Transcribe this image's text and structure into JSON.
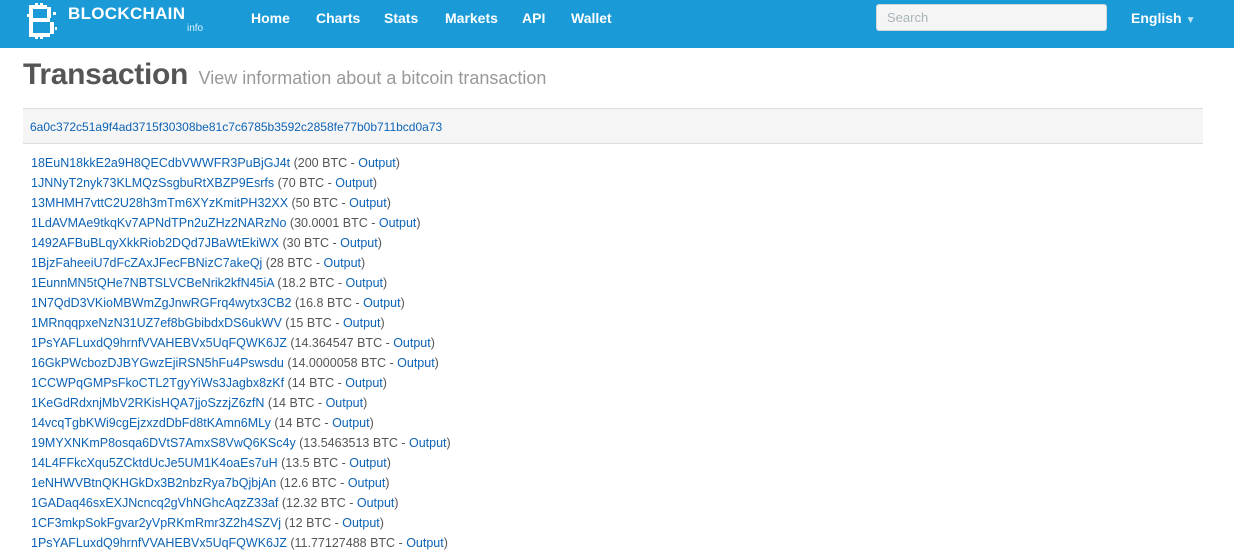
{
  "nav": {
    "brand": "BLOCKCHAIN",
    "brand_sub": "info",
    "links": [
      "Home",
      "Charts",
      "Stats",
      "Markets",
      "API",
      "Wallet"
    ],
    "search_placeholder": "Search",
    "language": "English"
  },
  "colors": {
    "navbar": "#1a9bd7",
    "link": "#0d63b6"
  },
  "header": {
    "title": "Transaction",
    "subtitle": "View information about a bitcoin transaction"
  },
  "transaction": {
    "hash": "6a0c372c51a9f4ad3715f30308be81c7c6785b3592c2858fe77b0b711bcd0a73"
  },
  "outputs": [
    {
      "address": "18EuN18kkE2a9H8QECdbVWWFR3PuBjGJ4t",
      "amount": "200 BTC",
      "label": "Output"
    },
    {
      "address": "1JNNyT2nyk73KLMQzSsgbuRtXBZP9Esrfs",
      "amount": "70 BTC",
      "label": "Output"
    },
    {
      "address": "13MHMH7vttC2U28h3mTm6XYzKmitPH32XX",
      "amount": "50 BTC",
      "label": "Output"
    },
    {
      "address": "1LdAVMAe9tkqKv7APNdTPn2uZHz2NARzNo",
      "amount": "30.0001 BTC",
      "label": "Output"
    },
    {
      "address": "1492AFBuBLqyXkkRiob2DQd7JBaWtEkiWX",
      "amount": "30 BTC",
      "label": "Output"
    },
    {
      "address": "1BjzFaheeiU7dFcZAxJFecFBNizC7akeQj",
      "amount": "28 BTC",
      "label": "Output"
    },
    {
      "address": "1EunnMN5tQHe7NBTSLVCBeNrik2kfN45iA",
      "amount": "18.2 BTC",
      "label": "Output"
    },
    {
      "address": "1N7QdD3VKioMBWmZgJnwRGFrq4wytx3CB2",
      "amount": "16.8 BTC",
      "label": "Output"
    },
    {
      "address": "1MRnqqpxeNzN31UZ7ef8bGbibdxDS6ukWV",
      "amount": "15 BTC",
      "label": "Output"
    },
    {
      "address": "1PsYAFLuxdQ9hrnfVVAHEBVx5UqFQWK6JZ",
      "amount": "14.364547 BTC",
      "label": "Output"
    },
    {
      "address": "16GkPWcbozDJBYGwzEjiRSN5hFu4Pswsdu",
      "amount": "14.0000058 BTC",
      "label": "Output"
    },
    {
      "address": "1CCWPqGMPsFkoCTL2TgyYiWs3Jagbx8zKf",
      "amount": "14 BTC",
      "label": "Output"
    },
    {
      "address": "1KeGdRdxnjMbV2RKisHQA7jjoSzzjZ6zfN",
      "amount": "14 BTC",
      "label": "Output"
    },
    {
      "address": "14vcqTgbKWi9cgEjzxzdDbFd8tKAmn6MLy",
      "amount": "14 BTC",
      "label": "Output"
    },
    {
      "address": "19MYXNKmP8osqa6DVtS7AmxS8VwQ6KSc4y",
      "amount": "13.5463513 BTC",
      "label": "Output"
    },
    {
      "address": "14L4FFkcXqu5ZCktdUcJe5UM1K4oaEs7uH",
      "amount": "13.5 BTC",
      "label": "Output"
    },
    {
      "address": "1eNHWVBtnQKHGkDx3B2nbzRya7bQjbjAn",
      "amount": "12.6 BTC",
      "label": "Output"
    },
    {
      "address": "1GADaq46sxEXJNcncq2gVhNGhcAqzZ33af",
      "amount": "12.32 BTC",
      "label": "Output"
    },
    {
      "address": "1CF3mkpSokFgvar2yVpRKmRmr3Z2h4SZVj",
      "amount": "12 BTC",
      "label": "Output"
    },
    {
      "address": "1PsYAFLuxdQ9hrnfVVAHEBVx5UqFQWK6JZ",
      "amount": "11.77127488 BTC",
      "label": "Output"
    }
  ]
}
